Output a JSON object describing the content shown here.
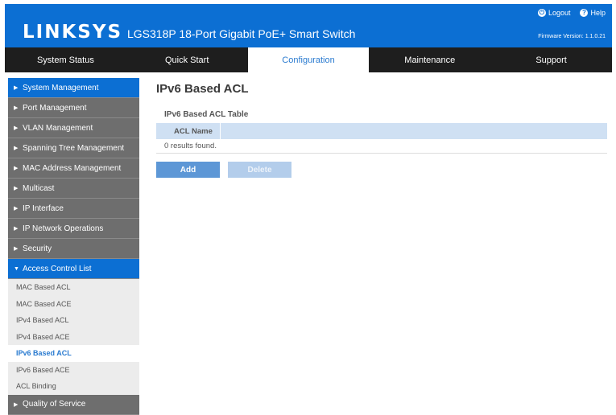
{
  "header": {
    "logo": "LINKSYS",
    "product": "LGS318P 18-Port Gigabit PoE+ Smart Switch",
    "logout_label": "Logout",
    "logout_icon": "logout-icon",
    "help_label": "Help",
    "help_icon": "help-icon",
    "firmware_label": "Firmware Version:",
    "firmware_value": "1.1.0.21"
  },
  "nav": {
    "tabs": [
      {
        "label": "System Status"
      },
      {
        "label": "Quick Start"
      },
      {
        "label": "Configuration",
        "active": true
      },
      {
        "label": "Maintenance"
      },
      {
        "label": "Support"
      }
    ]
  },
  "sidebar": {
    "items": [
      {
        "label": "System Management"
      },
      {
        "label": "Port Management"
      },
      {
        "label": "VLAN Management"
      },
      {
        "label": "Spanning Tree Management"
      },
      {
        "label": "MAC Address Management"
      },
      {
        "label": "Multicast"
      },
      {
        "label": "IP Interface"
      },
      {
        "label": "IP Network Operations"
      },
      {
        "label": "Security"
      },
      {
        "label": "Access Control List",
        "expanded": true
      }
    ],
    "subitems": [
      {
        "label": "MAC Based ACL"
      },
      {
        "label": "MAC Based ACE"
      },
      {
        "label": "IPv4 Based ACL"
      },
      {
        "label": "IPv4 Based ACE"
      },
      {
        "label": "IPv6 Based ACL",
        "active": true
      },
      {
        "label": "IPv6 Based ACE"
      },
      {
        "label": "ACL Binding"
      }
    ],
    "last_item": {
      "label": "Quality of Service"
    }
  },
  "main": {
    "title": "IPv6 Based ACL",
    "table_title": "IPv6 Based ACL Table",
    "columns": [
      "ACL Name"
    ],
    "result_text": "0 results found.",
    "add_label": "Add",
    "delete_label": "Delete"
  },
  "colors": {
    "brand_blue": "#0c6fd3",
    "nav_bg": "#1e1e1e",
    "sidebar_item_bg": "#6e6e6e",
    "table_header_bg": "#cfe0f3"
  }
}
